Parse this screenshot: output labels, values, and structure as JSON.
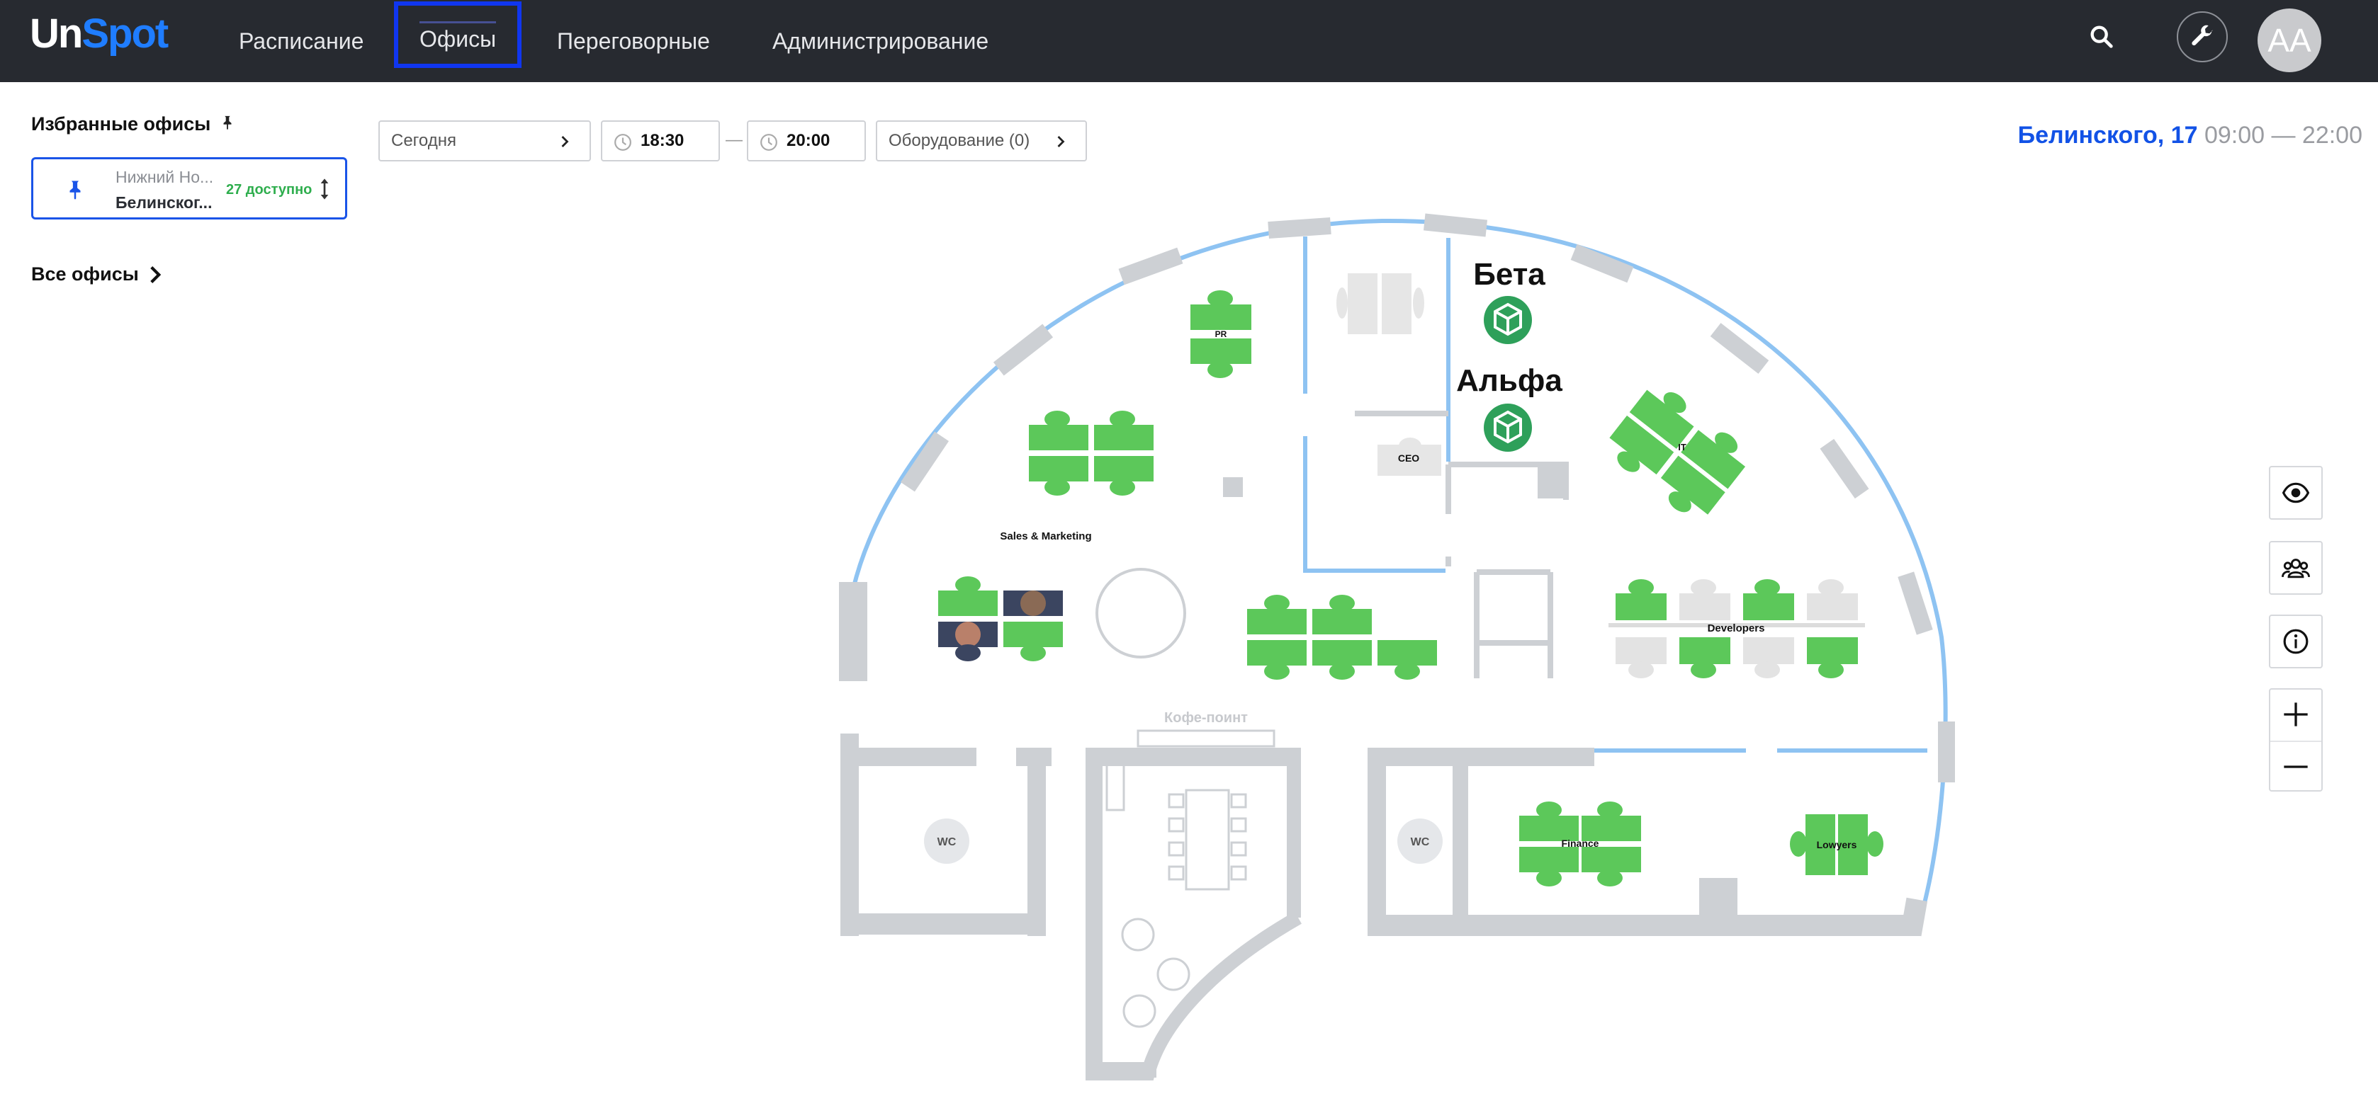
{
  "header": {
    "logo_un": "Un",
    "logo_spot": "Spot",
    "nav": [
      {
        "label": "Расписание"
      },
      {
        "label": "Офисы",
        "active": true
      },
      {
        "label": "Переговорные"
      },
      {
        "label": "Администрирование"
      }
    ],
    "avatar_initials": "AA",
    "icons": [
      "search-icon",
      "wrench-icon"
    ]
  },
  "sidebar": {
    "favorites_title": "Избранные офисы",
    "favorite": {
      "city": "Нижний Но...",
      "address": "Белинског...",
      "available": "27 доступно"
    },
    "all_offices": "Все офисы"
  },
  "filters": {
    "date": "Сегодня",
    "time_from": "18:30",
    "time_to": "20:00",
    "equipment": "Оборудование (0)"
  },
  "office": {
    "name": "Белинского, 17",
    "hours": "09:00 — 22:00"
  },
  "map": {
    "rooms": {
      "beta": "Бета",
      "alpha": "Альфа"
    },
    "zones": {
      "pr": "PR",
      "ceo": "CEO",
      "it": "IT",
      "sales": "Sales & Marketing",
      "developers": "Developers",
      "coffee": "Кофе-поинт",
      "wc1": "WC",
      "wc2": "WC",
      "finance": "Finance",
      "lawyers": "Lowyers"
    }
  },
  "colors": {
    "accent": "#1252e6",
    "header_bg": "#272a30",
    "free_desk": "#5cc85a",
    "busy_desk": "#e3e3e3",
    "wall": "#cdd0d4",
    "glass": "#8ec3f2"
  }
}
